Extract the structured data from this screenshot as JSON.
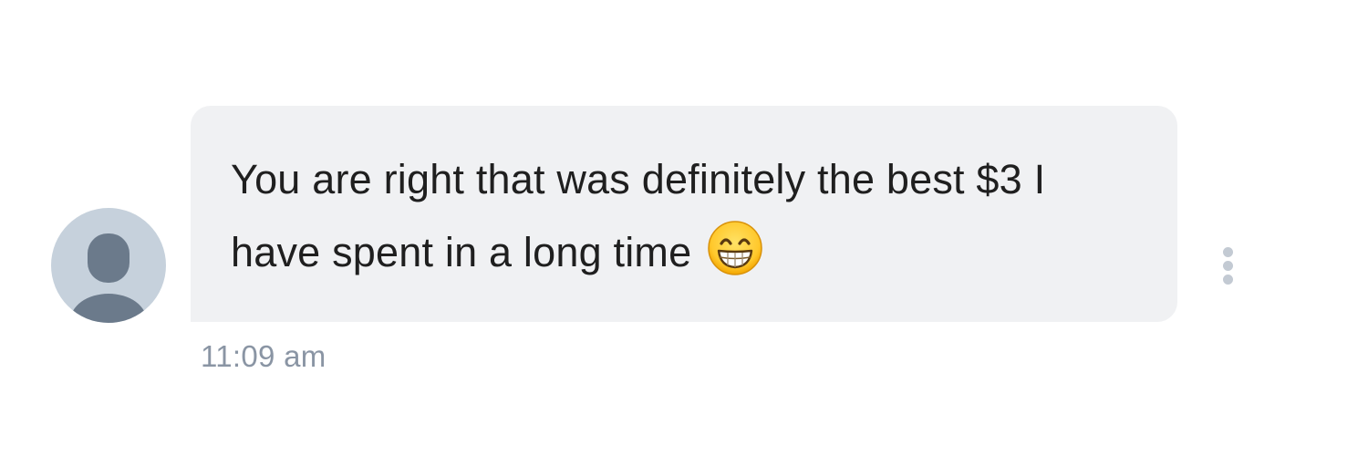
{
  "message": {
    "text": "You are right that was definitely the best $3 I have spent in a long time",
    "emoji": "grinning-face-with-smiling-eyes",
    "timestamp": "11:09 am"
  },
  "colors": {
    "bubble_background": "#f0f1f3",
    "avatar_background": "#c6d1dc",
    "avatar_silhouette": "#6b7a8b",
    "timestamp_text": "#8a95a4",
    "more_dots": "#c3cad3"
  },
  "icons": {
    "avatar": "person-silhouette-icon",
    "more": "vertical-ellipsis-icon"
  }
}
